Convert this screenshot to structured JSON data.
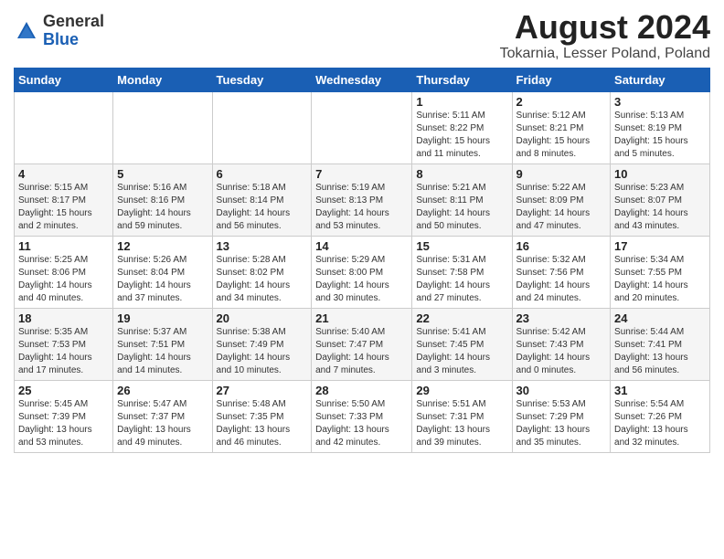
{
  "logo": {
    "general": "General",
    "blue": "Blue"
  },
  "header": {
    "title": "August 2024",
    "subtitle": "Tokarnia, Lesser Poland, Poland"
  },
  "weekdays": [
    "Sunday",
    "Monday",
    "Tuesday",
    "Wednesday",
    "Thursday",
    "Friday",
    "Saturday"
  ],
  "weeks": [
    [
      {
        "day": "",
        "info": ""
      },
      {
        "day": "",
        "info": ""
      },
      {
        "day": "",
        "info": ""
      },
      {
        "day": "",
        "info": ""
      },
      {
        "day": "1",
        "info": "Sunrise: 5:11 AM\nSunset: 8:22 PM\nDaylight: 15 hours\nand 11 minutes."
      },
      {
        "day": "2",
        "info": "Sunrise: 5:12 AM\nSunset: 8:21 PM\nDaylight: 15 hours\nand 8 minutes."
      },
      {
        "day": "3",
        "info": "Sunrise: 5:13 AM\nSunset: 8:19 PM\nDaylight: 15 hours\nand 5 minutes."
      }
    ],
    [
      {
        "day": "4",
        "info": "Sunrise: 5:15 AM\nSunset: 8:17 PM\nDaylight: 15 hours\nand 2 minutes."
      },
      {
        "day": "5",
        "info": "Sunrise: 5:16 AM\nSunset: 8:16 PM\nDaylight: 14 hours\nand 59 minutes."
      },
      {
        "day": "6",
        "info": "Sunrise: 5:18 AM\nSunset: 8:14 PM\nDaylight: 14 hours\nand 56 minutes."
      },
      {
        "day": "7",
        "info": "Sunrise: 5:19 AM\nSunset: 8:13 PM\nDaylight: 14 hours\nand 53 minutes."
      },
      {
        "day": "8",
        "info": "Sunrise: 5:21 AM\nSunset: 8:11 PM\nDaylight: 14 hours\nand 50 minutes."
      },
      {
        "day": "9",
        "info": "Sunrise: 5:22 AM\nSunset: 8:09 PM\nDaylight: 14 hours\nand 47 minutes."
      },
      {
        "day": "10",
        "info": "Sunrise: 5:23 AM\nSunset: 8:07 PM\nDaylight: 14 hours\nand 43 minutes."
      }
    ],
    [
      {
        "day": "11",
        "info": "Sunrise: 5:25 AM\nSunset: 8:06 PM\nDaylight: 14 hours\nand 40 minutes."
      },
      {
        "day": "12",
        "info": "Sunrise: 5:26 AM\nSunset: 8:04 PM\nDaylight: 14 hours\nand 37 minutes."
      },
      {
        "day": "13",
        "info": "Sunrise: 5:28 AM\nSunset: 8:02 PM\nDaylight: 14 hours\nand 34 minutes."
      },
      {
        "day": "14",
        "info": "Sunrise: 5:29 AM\nSunset: 8:00 PM\nDaylight: 14 hours\nand 30 minutes."
      },
      {
        "day": "15",
        "info": "Sunrise: 5:31 AM\nSunset: 7:58 PM\nDaylight: 14 hours\nand 27 minutes."
      },
      {
        "day": "16",
        "info": "Sunrise: 5:32 AM\nSunset: 7:56 PM\nDaylight: 14 hours\nand 24 minutes."
      },
      {
        "day": "17",
        "info": "Sunrise: 5:34 AM\nSunset: 7:55 PM\nDaylight: 14 hours\nand 20 minutes."
      }
    ],
    [
      {
        "day": "18",
        "info": "Sunrise: 5:35 AM\nSunset: 7:53 PM\nDaylight: 14 hours\nand 17 minutes."
      },
      {
        "day": "19",
        "info": "Sunrise: 5:37 AM\nSunset: 7:51 PM\nDaylight: 14 hours\nand 14 minutes."
      },
      {
        "day": "20",
        "info": "Sunrise: 5:38 AM\nSunset: 7:49 PM\nDaylight: 14 hours\nand 10 minutes."
      },
      {
        "day": "21",
        "info": "Sunrise: 5:40 AM\nSunset: 7:47 PM\nDaylight: 14 hours\nand 7 minutes."
      },
      {
        "day": "22",
        "info": "Sunrise: 5:41 AM\nSunset: 7:45 PM\nDaylight: 14 hours\nand 3 minutes."
      },
      {
        "day": "23",
        "info": "Sunrise: 5:42 AM\nSunset: 7:43 PM\nDaylight: 14 hours\nand 0 minutes."
      },
      {
        "day": "24",
        "info": "Sunrise: 5:44 AM\nSunset: 7:41 PM\nDaylight: 13 hours\nand 56 minutes."
      }
    ],
    [
      {
        "day": "25",
        "info": "Sunrise: 5:45 AM\nSunset: 7:39 PM\nDaylight: 13 hours\nand 53 minutes."
      },
      {
        "day": "26",
        "info": "Sunrise: 5:47 AM\nSunset: 7:37 PM\nDaylight: 13 hours\nand 49 minutes."
      },
      {
        "day": "27",
        "info": "Sunrise: 5:48 AM\nSunset: 7:35 PM\nDaylight: 13 hours\nand 46 minutes."
      },
      {
        "day": "28",
        "info": "Sunrise: 5:50 AM\nSunset: 7:33 PM\nDaylight: 13 hours\nand 42 minutes."
      },
      {
        "day": "29",
        "info": "Sunrise: 5:51 AM\nSunset: 7:31 PM\nDaylight: 13 hours\nand 39 minutes."
      },
      {
        "day": "30",
        "info": "Sunrise: 5:53 AM\nSunset: 7:29 PM\nDaylight: 13 hours\nand 35 minutes."
      },
      {
        "day": "31",
        "info": "Sunrise: 5:54 AM\nSunset: 7:26 PM\nDaylight: 13 hours\nand 32 minutes."
      }
    ]
  ]
}
